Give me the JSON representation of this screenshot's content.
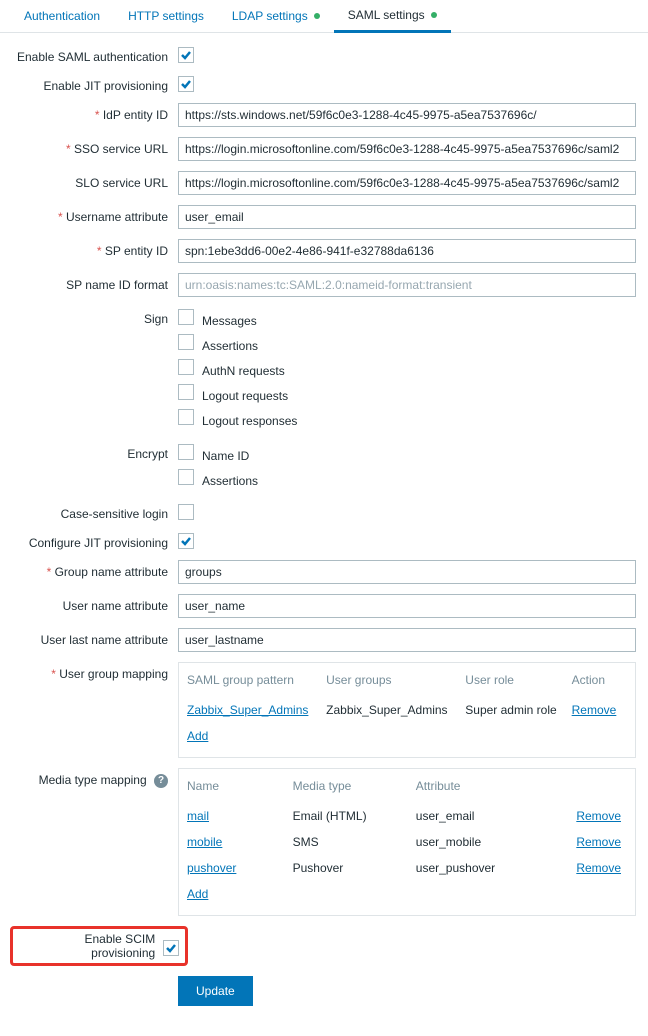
{
  "tabs": {
    "auth": "Authentication",
    "http": "HTTP settings",
    "ldap": "LDAP settings",
    "saml": "SAML settings"
  },
  "labels": {
    "enable_saml": "Enable SAML authentication",
    "enable_jit": "Enable JIT provisioning",
    "idp_entity": "IdP entity ID",
    "sso_url": "SSO service URL",
    "slo_url": "SLO service URL",
    "username_attr": "Username attribute",
    "sp_entity": "SP entity ID",
    "sp_nameid": "SP name ID format",
    "sign": "Sign",
    "encrypt": "Encrypt",
    "case_sensitive": "Case-sensitive login",
    "configure_jit": "Configure JIT provisioning",
    "group_name_attr": "Group name attribute",
    "user_name_attr": "User name attribute",
    "user_lastname_attr": "User last name attribute",
    "user_group_mapping": "User group mapping",
    "media_type_mapping": "Media type mapping",
    "enable_scim": "Enable SCIM provisioning"
  },
  "values": {
    "idp_entity": "https://sts.windows.net/59f6c0e3-1288-4c45-9975-a5ea7537696c/",
    "sso_url": "https://login.microsoftonline.com/59f6c0e3-1288-4c45-9975-a5ea7537696c/saml2",
    "slo_url": "https://login.microsoftonline.com/59f6c0e3-1288-4c45-9975-a5ea7537696c/saml2",
    "username_attr": "user_email",
    "sp_entity": "spn:1ebe3dd6-00e2-4e86-941f-e32788da6136",
    "sp_nameid_placeholder": "urn:oasis:names:tc:SAML:2.0:nameid-format:transient",
    "group_name_attr": "groups",
    "user_name_attr": "user_name",
    "user_lastname_attr": "user_lastname"
  },
  "sign": {
    "messages": "Messages",
    "assertions": "Assertions",
    "authn": "AuthN requests",
    "logout_req": "Logout requests",
    "logout_resp": "Logout responses"
  },
  "encrypt": {
    "nameid": "Name ID",
    "assertions": "Assertions"
  },
  "group_mapping": {
    "headers": {
      "pattern": "SAML group pattern",
      "groups": "User groups",
      "role": "User role",
      "action": "Action"
    },
    "rows": [
      {
        "pattern": "Zabbix_Super_Admins",
        "groups": "Zabbix_Super_Admins",
        "role": "Super admin role",
        "action": "Remove"
      }
    ],
    "add": "Add"
  },
  "media_mapping": {
    "headers": {
      "name": "Name",
      "type": "Media type",
      "attr": "Attribute"
    },
    "rows": [
      {
        "name": "mail",
        "type": "Email (HTML)",
        "attr": "user_email",
        "action": "Remove"
      },
      {
        "name": "mobile",
        "type": "SMS",
        "attr": "user_mobile",
        "action": "Remove"
      },
      {
        "name": "pushover",
        "type": "Pushover",
        "attr": "user_pushover",
        "action": "Remove"
      }
    ],
    "add": "Add"
  },
  "update_btn": "Update"
}
